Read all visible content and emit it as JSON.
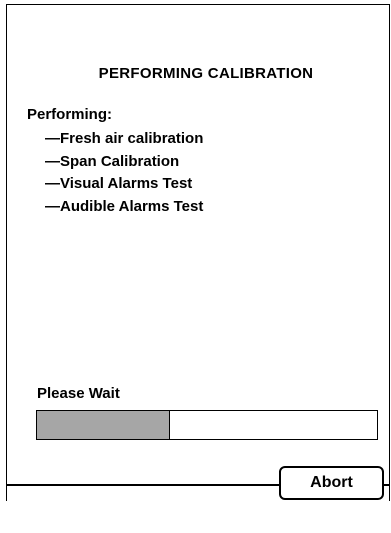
{
  "dialog": {
    "title": "PERFORMING CALIBRATION",
    "performing_label": "Performing:",
    "steps": [
      "—Fresh air calibration",
      "—Span Calibration",
      "—Visual Alarms Test",
      "—Audible Alarms Test"
    ]
  },
  "status": {
    "wait_label": "Please Wait",
    "progress_fraction": 0.39,
    "progress_fill_color": "#a6a6a6"
  },
  "footer": {
    "abort_label": "Abort"
  }
}
